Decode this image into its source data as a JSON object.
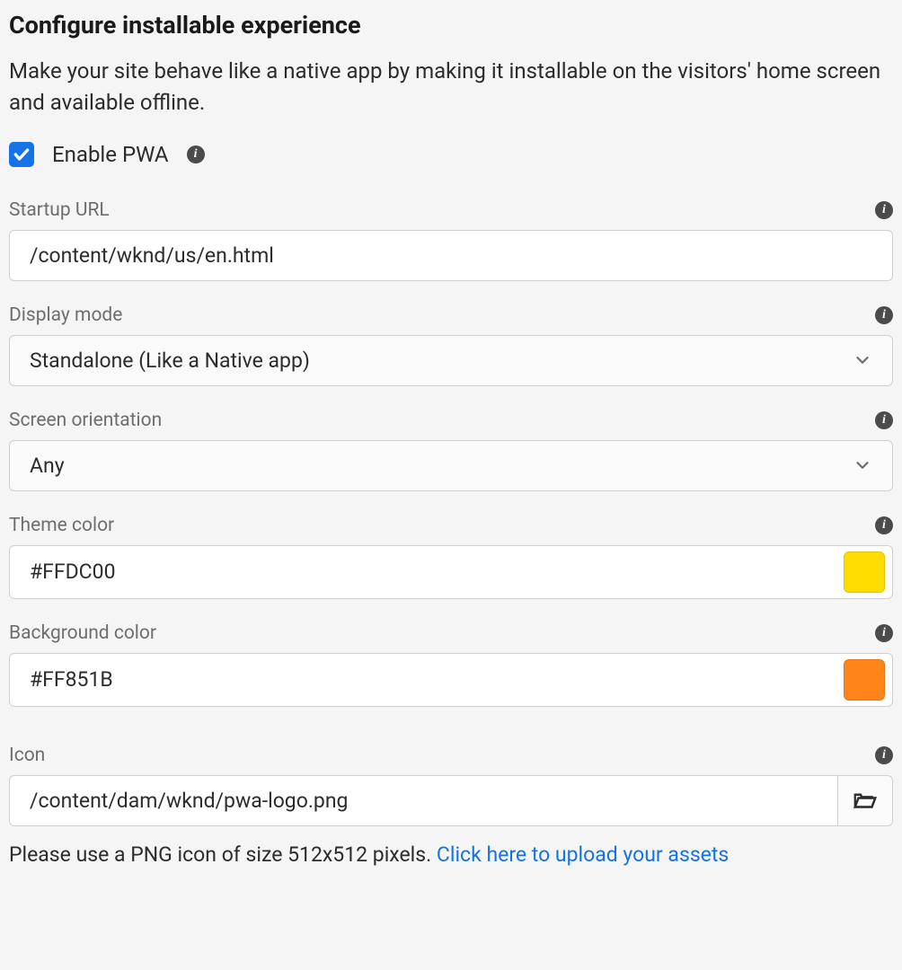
{
  "header": {
    "title": "Configure installable experience",
    "subtitle": "Make your site behave like a native app by making it installable on the visitors' home screen and available offline."
  },
  "enable": {
    "label": "Enable PWA",
    "checked": true
  },
  "fields": {
    "startup_url": {
      "label": "Startup URL",
      "value": "/content/wknd/us/en.html"
    },
    "display_mode": {
      "label": "Display mode",
      "value": "Standalone (Like a Native app)"
    },
    "screen_orientation": {
      "label": "Screen orientation",
      "value": "Any"
    },
    "theme_color": {
      "label": "Theme color",
      "value": "#FFDC00",
      "swatch": "#FFDC00"
    },
    "background_color": {
      "label": "Background color",
      "value": "#FF851B",
      "swatch": "#FF851B"
    },
    "icon": {
      "label": "Icon",
      "value": "/content/dam/wknd/pwa-logo.png",
      "hint_prefix": "Please use a PNG icon of size 512x512 pixels. ",
      "hint_link": "Click here to upload your assets"
    }
  }
}
